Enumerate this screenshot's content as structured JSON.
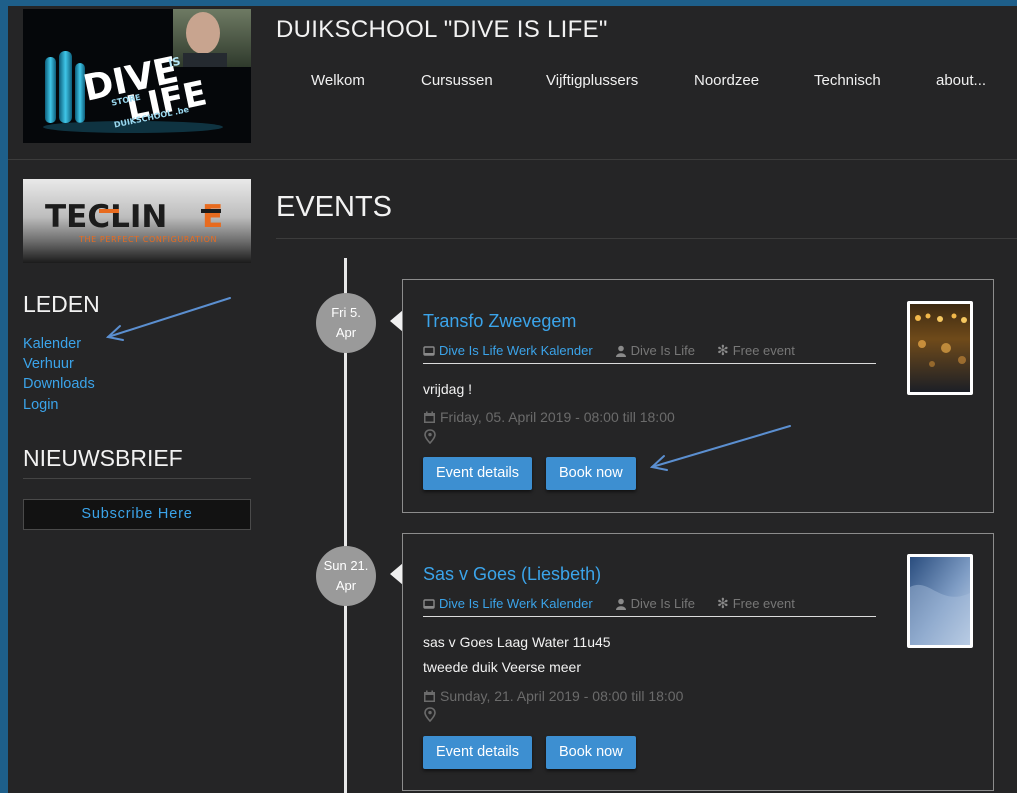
{
  "site": {
    "title": "DUIKSCHOOL \"DIVE IS LIFE\"",
    "logo_text": "DIVE IS LIFE STORE & DUIKSCHOOL .be",
    "partner_logo_text": "TECLINE THE PERFECT CONFIGURATION"
  },
  "nav": {
    "items": [
      {
        "label": "Welkom"
      },
      {
        "label": "Cursussen"
      },
      {
        "label": "Vijftigplussers"
      },
      {
        "label": "Noordzee"
      },
      {
        "label": "Technisch"
      },
      {
        "label": "about..."
      }
    ]
  },
  "sidebar": {
    "leden_heading": "LEDEN",
    "links": [
      {
        "label": "Kalender"
      },
      {
        "label": "Verhuur"
      },
      {
        "label": "Downloads"
      },
      {
        "label": "Login"
      }
    ],
    "nieuwsbrief_heading": "NIEUWSBRIEF",
    "subscribe_label": "Subscribe Here"
  },
  "events": {
    "heading": "EVENTS",
    "items": [
      {
        "date_line1": "Fri 5.",
        "date_line2": "Apr",
        "title": "Transfo Zwevegem",
        "calendar": "Dive Is Life Werk Kalender",
        "organizer": "Dive Is Life",
        "price": "Free event",
        "description": [
          "vrijdag !"
        ],
        "when": "Friday, 05. April 2019 - 08:00 till 18:00",
        "details_label": "Event details",
        "book_label": "Book now",
        "thumb_icon": "night-lights-photo"
      },
      {
        "date_line1": "Sun 21.",
        "date_line2": "Apr",
        "title": "Sas v Goes (Liesbeth)",
        "calendar": "Dive Is Life Werk Kalender",
        "organizer": "Dive Is Life",
        "price": "Free event",
        "description": [
          "sas v Goes Laag Water 11u45",
          "tweede duik Veerse meer"
        ],
        "when": "Sunday, 21. April 2019 - 08:00 till 18:00",
        "details_label": "Event details",
        "book_label": "Book now",
        "thumb_icon": "underwater-photo"
      }
    ]
  },
  "annotations": {
    "color": "#5b8fd0"
  },
  "colors": {
    "link": "#3ba4ea",
    "button": "#3d8fd1",
    "page_bg": "#252526",
    "frame": "#1e5f8a"
  }
}
